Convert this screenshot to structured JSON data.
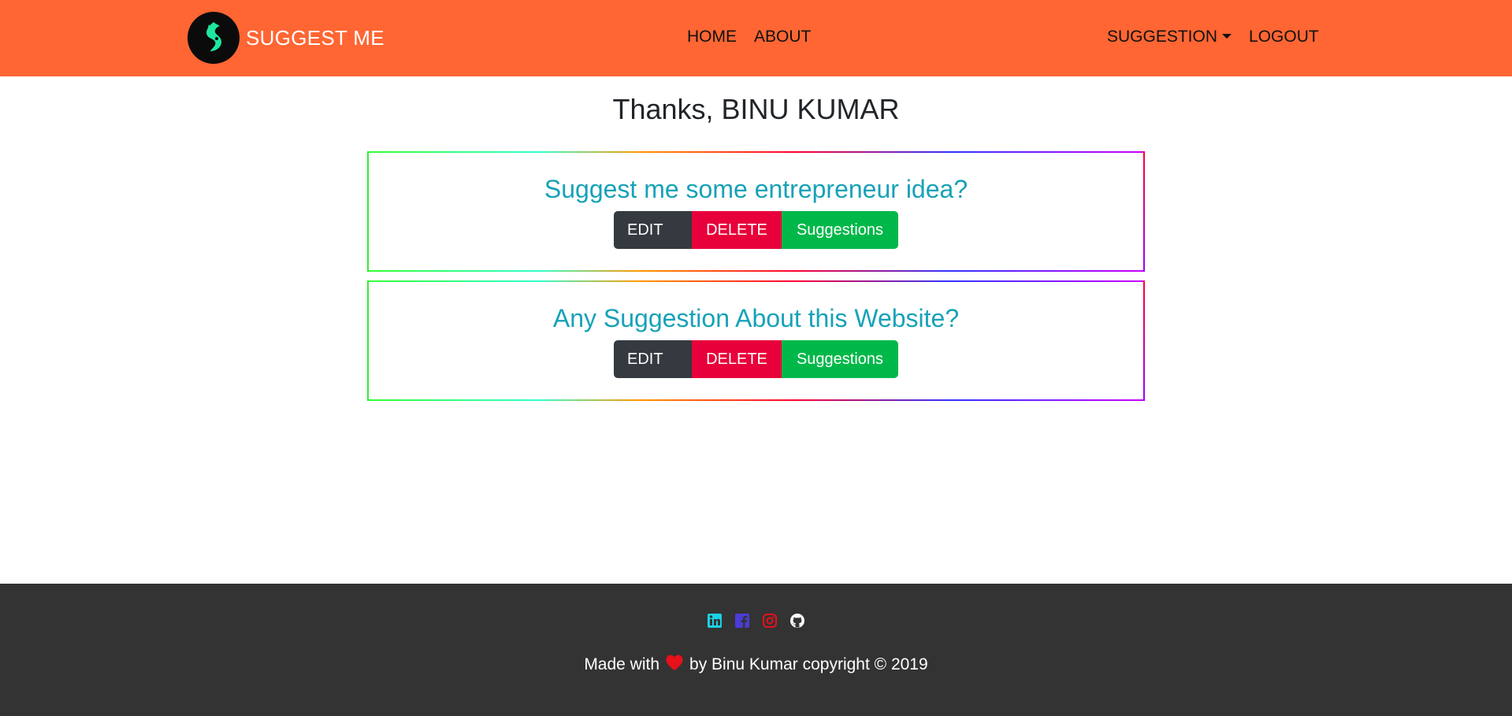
{
  "navbar": {
    "brand": "SUGGEST ME",
    "background": "#ff6633",
    "center_links": [
      "HOME",
      "ABOUT"
    ],
    "suggestion_dropdown": "SUGGESTION",
    "logout": "LOGOUT"
  },
  "greeting": "Thanks, BINU KUMAR",
  "questions": [
    {
      "title": "Suggest me some entrepreneur idea?",
      "edit": "EDIT",
      "delete": "DELETE",
      "suggestions": "Suggestions"
    },
    {
      "title": "Any Suggestion About this Website?",
      "edit": "EDIT",
      "delete": "DELETE",
      "suggestions": "Suggestions"
    }
  ],
  "footer": {
    "social_icons": [
      "linkedin-icon",
      "facebook-icon",
      "instagram-icon",
      "github-icon"
    ],
    "made_with": "Made with",
    "credit": "by Binu Kumar copyright © 2019"
  },
  "colors": {
    "accent": "#17a2b8",
    "edit": "#343a40",
    "delete": "#e8003a",
    "suggestions": "#00b84a",
    "footer": "#333333"
  }
}
